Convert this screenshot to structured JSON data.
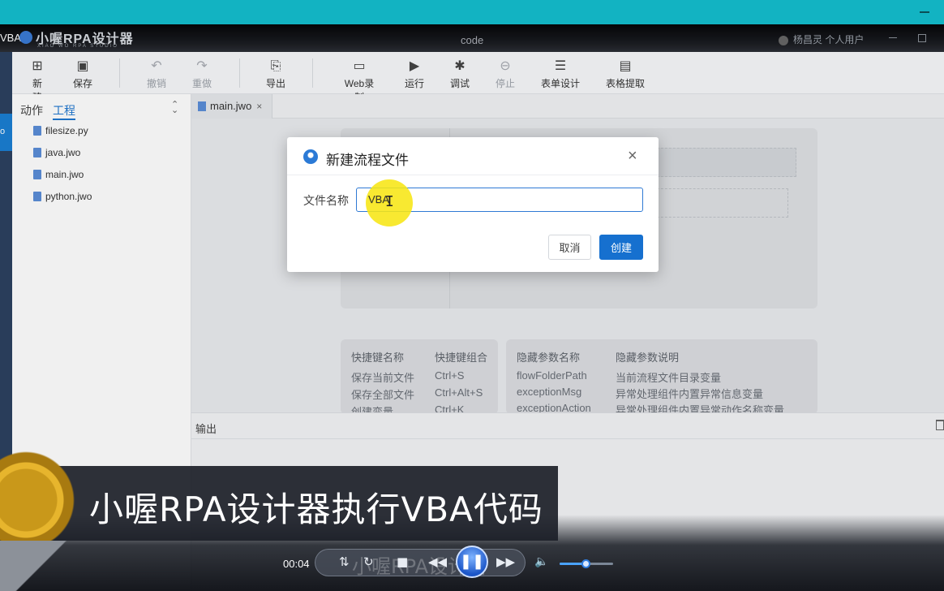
{
  "titlebar": {
    "left_label": "VBA",
    "brand": "小喔RPA设计器",
    "brand_sub": "XIAO WO RPA STUDIO",
    "center": "code",
    "user": "杨昌灵 个人用户"
  },
  "leftstrip": {
    "active_label": "o"
  },
  "toolbar": {
    "new": "新建",
    "save": "保存",
    "undo": "撤销",
    "redo": "重做",
    "export": "导出",
    "web_record": "Web录制",
    "run": "运行",
    "debug": "调试",
    "stop": "停止",
    "form_design": "表单设计",
    "table_extract": "表格提取"
  },
  "sidebar": {
    "tab_actions": "动作",
    "tab_project": "工程",
    "files": [
      "filesize.py",
      "java.jwo",
      "main.jwo",
      "python.jwo"
    ]
  },
  "editor": {
    "tab_name": "main.jwo",
    "tab_close": "×"
  },
  "hints": {
    "shortcut_header": "快捷键名称",
    "combo_header": "快捷键组合",
    "shortcuts": [
      {
        "name": "保存当前文件",
        "combo": "Ctrl+S"
      },
      {
        "name": "保存全部文件",
        "combo": "Ctrl+Alt+S"
      },
      {
        "name": "创建变量",
        "combo": "Ctrl+K"
      }
    ],
    "param_header": "隐藏参数名称",
    "desc_header": "隐藏参数说明",
    "params": [
      {
        "name": "flowFolderPath",
        "desc": "当前流程文件目录变量"
      },
      {
        "name": "exceptionMsg",
        "desc": "异常处理组件内置异常信息变量"
      },
      {
        "name": "exceptionAction",
        "desc": "异常处理组件内置异常动作名称变量"
      }
    ]
  },
  "output": {
    "title": "输出"
  },
  "dialog": {
    "title": "新建流程文件",
    "close": "×",
    "label": "文件名称",
    "input_value": "VBA",
    "cancel": "取消",
    "create": "创建"
  },
  "player": {
    "caption": "小喔RPA设计器执行VBA代码",
    "time": "00:04",
    "watermark": "小喔RPA设计器",
    "volume": 0.5
  }
}
